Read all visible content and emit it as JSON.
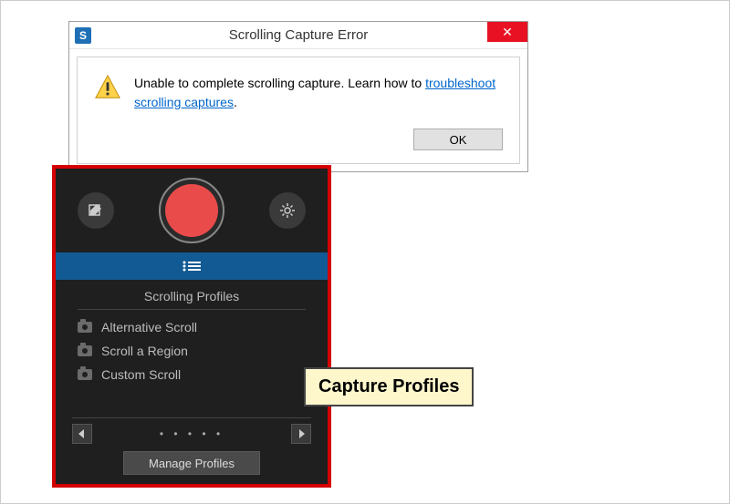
{
  "dialog": {
    "title": "Scrolling Capture Error",
    "app_icon_letter": "S",
    "close_glyph": "✕",
    "message_prefix": "Unable to complete scrolling capture. Learn how to ",
    "link_text": "troubleshoot scrolling captures",
    "message_suffix": ".",
    "ok_label": "OK"
  },
  "panel": {
    "section_title": "Scrolling Profiles",
    "profiles": [
      {
        "label": "Alternative Scroll"
      },
      {
        "label": "Scroll a Region"
      },
      {
        "label": "Custom Scroll"
      }
    ],
    "pager_dots": "• • • • •",
    "manage_label": "Manage Profiles"
  },
  "callout": {
    "text": "Capture Profiles"
  }
}
